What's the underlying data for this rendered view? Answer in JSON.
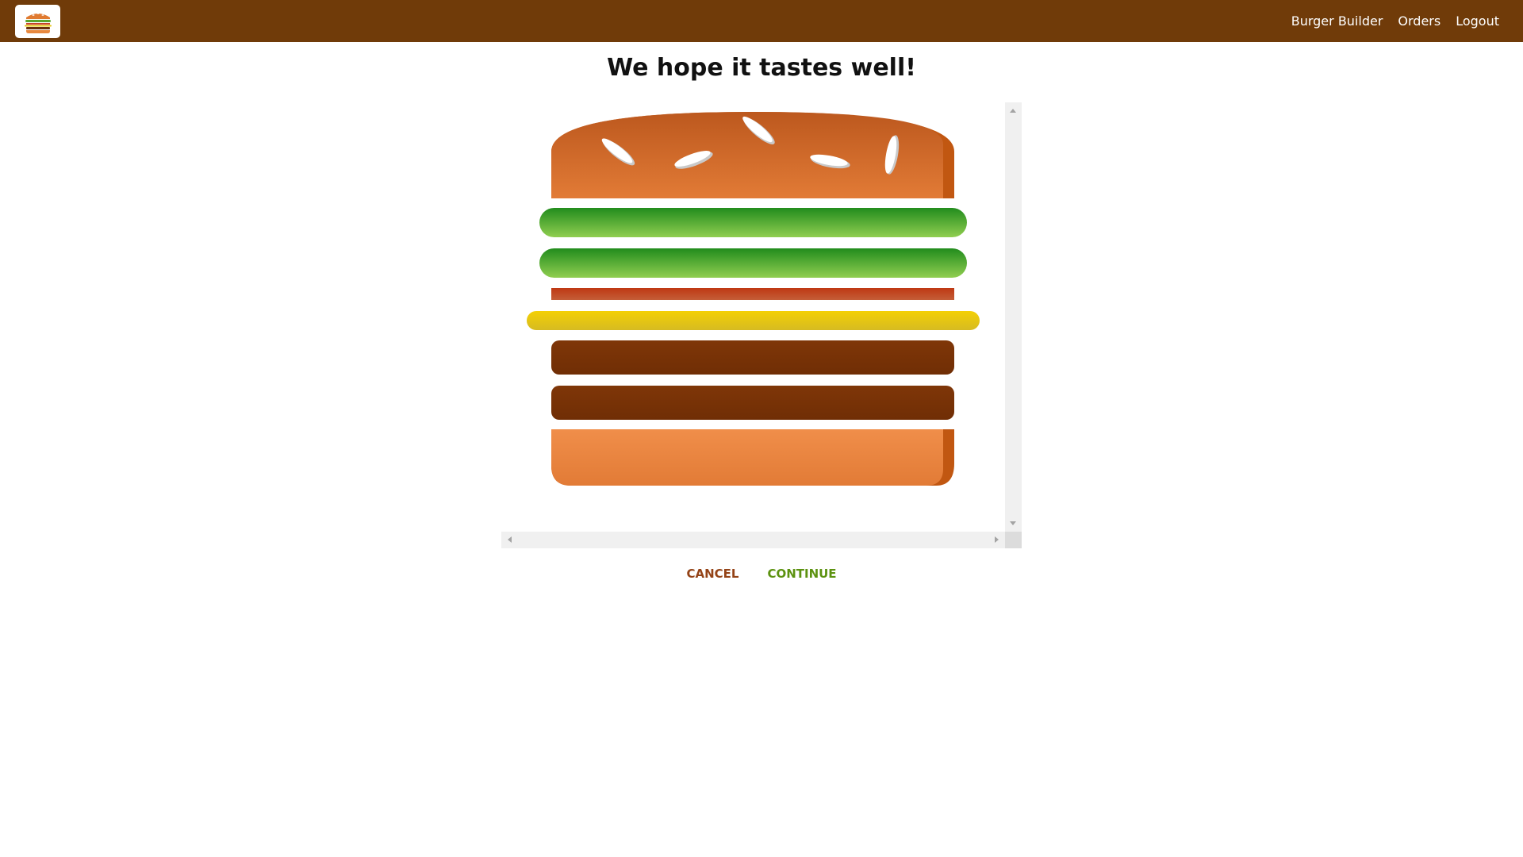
{
  "header": {
    "logo_icon": "burger-logo-icon",
    "nav": [
      {
        "label": "Burger Builder"
      },
      {
        "label": "Orders"
      },
      {
        "label": "Logout"
      }
    ]
  },
  "main": {
    "title": "We hope it tastes well!",
    "burger": {
      "layers": [
        "bread-top",
        "salad",
        "salad",
        "bacon",
        "cheese",
        "meat",
        "meat",
        "bread-bottom"
      ]
    },
    "buttons": {
      "cancel": "CANCEL",
      "continue": "CONTINUE"
    }
  },
  "colors": {
    "toolbar": "#703b09",
    "cancel": "#944317",
    "continue": "#5c9210"
  }
}
